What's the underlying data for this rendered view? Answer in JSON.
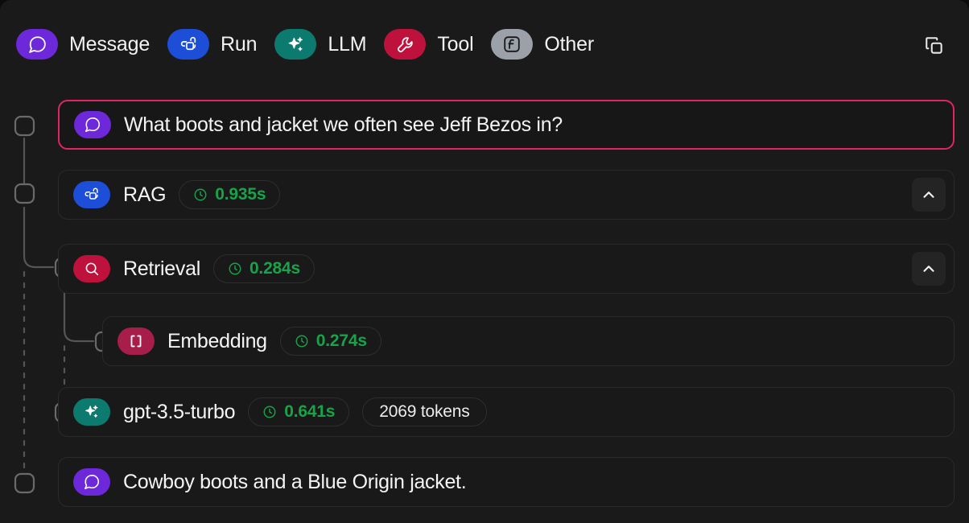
{
  "legend": {
    "items": [
      {
        "label": "Message",
        "icon": "chat-bubble-icon",
        "color": "#6d28d9"
      },
      {
        "label": "Run",
        "icon": "run-nodes-icon",
        "color": "#1d4ed8"
      },
      {
        "label": "LLM",
        "icon": "sparkles-icon",
        "color": "#0d7a6f"
      },
      {
        "label": "Tool",
        "icon": "wrench-icon",
        "color": "#be123c"
      },
      {
        "label": "Other",
        "icon": "function-icon",
        "color": "#9ca0a8"
      }
    ],
    "copy_button": "copy-icon"
  },
  "trace": {
    "rows": [
      {
        "id": "user-message",
        "kind": "message",
        "title": "What boots and jacket we often see Jeff Bezos in?",
        "icon": "chat-bubble-icon",
        "icon_color": "#6d28d9",
        "selected": true,
        "indent": 0,
        "duration": null,
        "tokens": null,
        "collapse": null
      },
      {
        "id": "rag-run",
        "kind": "run",
        "title": "RAG",
        "icon": "run-nodes-icon",
        "icon_color": "#1d4ed8",
        "selected": false,
        "indent": 0,
        "duration": "0.935s",
        "tokens": null,
        "collapse": "chevron-up-icon"
      },
      {
        "id": "retrieval-tool",
        "kind": "tool",
        "title": "Retrieval",
        "icon": "search-icon",
        "icon_color": "#be123c",
        "selected": false,
        "indent": 1,
        "duration": "0.284s",
        "tokens": null,
        "collapse": "chevron-up-icon"
      },
      {
        "id": "embedding-tool",
        "kind": "tool",
        "title": "Embedding",
        "icon": "brackets-icon",
        "icon_color": "#a61e49",
        "selected": false,
        "indent": 2,
        "duration": "0.274s",
        "tokens": null,
        "collapse": null
      },
      {
        "id": "llm-call",
        "kind": "llm",
        "title": "gpt-3.5-turbo",
        "icon": "sparkles-icon",
        "icon_color": "#0d7a6f",
        "selected": false,
        "indent": 1,
        "duration": "0.641s",
        "tokens": "2069 tokens",
        "collapse": null
      },
      {
        "id": "assistant-message",
        "kind": "message",
        "title": "Cowboy boots and a Blue Origin jacket.",
        "icon": "chat-bubble-icon",
        "icon_color": "#6d28d9",
        "selected": false,
        "indent": 0,
        "duration": null,
        "tokens": null,
        "collapse": null
      }
    ],
    "colors": {
      "selected_border": "#e0265e",
      "duration_text": "#18a349",
      "row_bg": "#191919",
      "row_border": "#2a2a2a",
      "canvas_bg": "#1a1a1a",
      "connector": "#555557"
    },
    "clock_icon": "clock-icon"
  }
}
